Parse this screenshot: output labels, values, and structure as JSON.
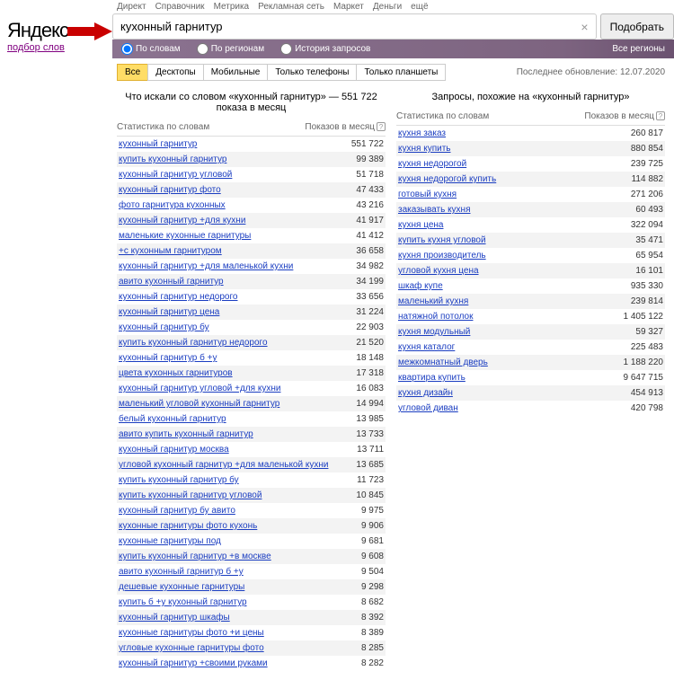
{
  "header_links": [
    "Директ",
    "Справочник",
    "Метрика",
    "Рекламная сеть",
    "Маркет",
    "Деньги",
    "ещё"
  ],
  "logo": "Яндекс",
  "logo_sub": "подбор слов",
  "search": {
    "value": "кухонный гарнитур",
    "submit": "Подобрать"
  },
  "filters": {
    "by_words": "По словам",
    "by_regions": "По регионам",
    "history": "История запросов",
    "all_regions": "Все регионы"
  },
  "tabs": [
    "Все",
    "Десктопы",
    "Мобильные",
    "Только телефоны",
    "Только планшеты"
  ],
  "update": "Последнее обновление: 12.07.2020",
  "left": {
    "title": "Что искали со словом «кухонный гарнитур» — 551 722 показа в месяц",
    "col1": "Статистика по словам",
    "col2": "Показов в месяц",
    "rows": [
      {
        "k": "кухонный гарнитур",
        "v": "551 722"
      },
      {
        "k": "купить кухонный гарнитур",
        "v": "99 389"
      },
      {
        "k": "кухонный гарнитур угловой",
        "v": "51 718"
      },
      {
        "k": "кухонный гарнитур фото",
        "v": "47 433"
      },
      {
        "k": "фото гарнитура кухонных",
        "v": "43 216"
      },
      {
        "k": "кухонный гарнитур +для кухни",
        "v": "41 917"
      },
      {
        "k": "маленькие кухонные гарнитуры",
        "v": "41 412"
      },
      {
        "k": "+с кухонным гарнитуром",
        "v": "36 658"
      },
      {
        "k": "кухонный гарнитур +для маленькой кухни",
        "v": "34 982"
      },
      {
        "k": "авито кухонный гарнитур",
        "v": "34 199"
      },
      {
        "k": "кухонный гарнитур недорого",
        "v": "33 656"
      },
      {
        "k": "кухонный гарнитур цена",
        "v": "31 224"
      },
      {
        "k": "кухонный гарнитур бу",
        "v": "22 903"
      },
      {
        "k": "купить кухонный гарнитур недорого",
        "v": "21 520"
      },
      {
        "k": "кухонный гарнитур б +у",
        "v": "18 148"
      },
      {
        "k": "цвета кухонных гарнитуров",
        "v": "17 318"
      },
      {
        "k": "кухонный гарнитур угловой +для кухни",
        "v": "16 083"
      },
      {
        "k": "маленький угловой кухонный гарнитур",
        "v": "14 994"
      },
      {
        "k": "белый кухонный гарнитур",
        "v": "13 985"
      },
      {
        "k": "авито купить кухонный гарнитур",
        "v": "13 733"
      },
      {
        "k": "кухонный гарнитур москва",
        "v": "13 711"
      },
      {
        "k": "угловой кухонный гарнитур +для маленькой кухни",
        "v": "13 685"
      },
      {
        "k": "купить кухонный гарнитур бу",
        "v": "11 723"
      },
      {
        "k": "купить кухонный гарнитур угловой",
        "v": "10 845"
      },
      {
        "k": "кухонный гарнитур бу авито",
        "v": "9 975"
      },
      {
        "k": "кухонные гарнитуры фото кухонь",
        "v": "9 906"
      },
      {
        "k": "кухонные гарнитуры под",
        "v": "9 681"
      },
      {
        "k": "купить кухонный гарнитур +в москве",
        "v": "9 608"
      },
      {
        "k": "авито кухонный гарнитур б +у",
        "v": "9 504"
      },
      {
        "k": "дешевые кухонные гарнитуры",
        "v": "9 298"
      },
      {
        "k": "купить б +у кухонный гарнитур",
        "v": "8 682"
      },
      {
        "k": "кухонный гарнитур шкафы",
        "v": "8 392"
      },
      {
        "k": "кухонные гарнитуры фото +и цены",
        "v": "8 389"
      },
      {
        "k": "угловые кухонные гарнитуры фото",
        "v": "8 285"
      },
      {
        "k": "кухонный гарнитур +своими руками",
        "v": "8 282"
      }
    ]
  },
  "right": {
    "title": "Запросы, похожие на «кухонный гарнитур»",
    "col1": "Статистика по словам",
    "col2": "Показов в месяц",
    "rows": [
      {
        "k": "кухня заказ",
        "v": "260 817"
      },
      {
        "k": "кухня купить",
        "v": "880 854"
      },
      {
        "k": "кухня недорогой",
        "v": "239 725"
      },
      {
        "k": "кухня недорогой купить",
        "v": "114 882"
      },
      {
        "k": "готовый кухня",
        "v": "271 206"
      },
      {
        "k": "заказывать кухня",
        "v": "60 493"
      },
      {
        "k": "кухня цена",
        "v": "322 094"
      },
      {
        "k": "купить кухня угловой",
        "v": "35 471"
      },
      {
        "k": "кухня производитель",
        "v": "65 954"
      },
      {
        "k": "угловой кухня цена",
        "v": "16 101"
      },
      {
        "k": "шкаф купе",
        "v": "935 330"
      },
      {
        "k": "маленький кухня",
        "v": "239 814"
      },
      {
        "k": "натяжной потолок",
        "v": "1 405 122"
      },
      {
        "k": "кухня модульный",
        "v": "59 327"
      },
      {
        "k": "кухня каталог",
        "v": "225 483"
      },
      {
        "k": "межкомнатный дверь",
        "v": "1 188 220"
      },
      {
        "k": "квартира купить",
        "v": "9 647 715"
      },
      {
        "k": "кухня дизайн",
        "v": "454 913"
      },
      {
        "k": "угловой диван",
        "v": "420 798"
      }
    ]
  }
}
